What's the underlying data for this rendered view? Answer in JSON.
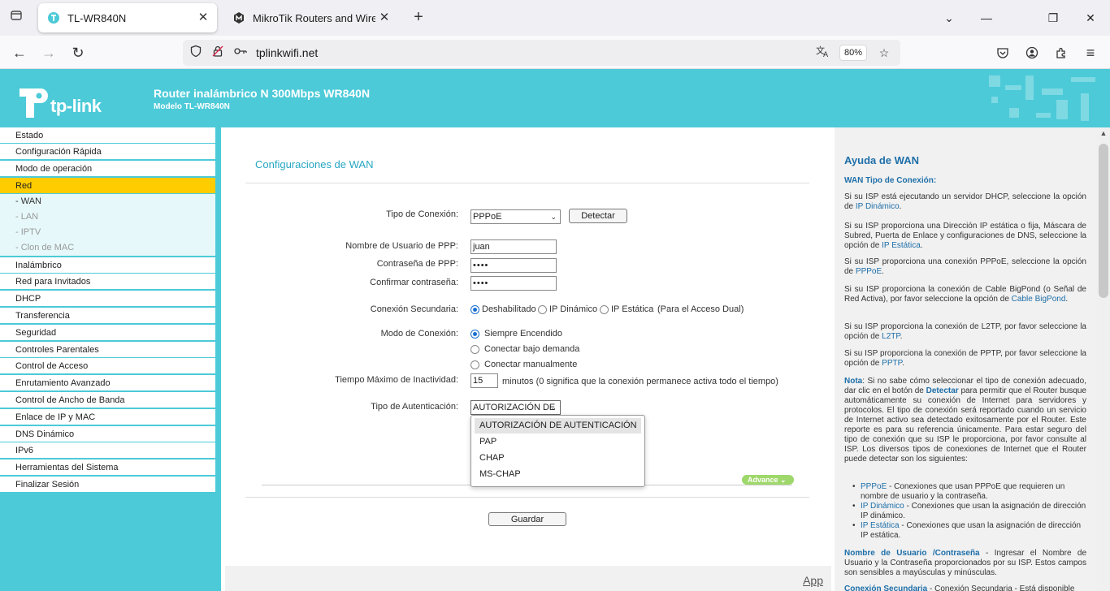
{
  "browser": {
    "tabs": [
      {
        "title": "TL-WR840N",
        "active": true
      },
      {
        "title": "MikroTik Routers and Wireless",
        "active": false
      }
    ],
    "url": "tplinkwifi.net",
    "zoom": "80%"
  },
  "header": {
    "logo_text": "tp-link",
    "title": "Router inalámbrico N 300Mbps WR840N",
    "model": "Modelo TL-WR840N",
    "brand_color": "#4ccad8"
  },
  "menu": {
    "items": [
      {
        "label": "Estado"
      },
      {
        "label": "Configuración Rápida"
      },
      {
        "label": "Modo de operación"
      },
      {
        "label": "Red",
        "active": true
      },
      {
        "label": "- WAN",
        "sub": true,
        "current": true
      },
      {
        "label": "- LAN",
        "sub": true
      },
      {
        "label": "- IPTV",
        "sub": true
      },
      {
        "label": "- Clon de MAC",
        "sub": true
      },
      {
        "label": "Inalámbrico"
      },
      {
        "label": "Red para Invitados"
      },
      {
        "label": "DHCP"
      },
      {
        "label": "Transferencia"
      },
      {
        "label": "Seguridad"
      },
      {
        "label": "Controles Parentales"
      },
      {
        "label": "Control de Acceso"
      },
      {
        "label": "Enrutamiento Avanzado"
      },
      {
        "label": "Control de Ancho de Banda"
      },
      {
        "label": "Enlace de IP y MAC"
      },
      {
        "label": "DNS Dinámico"
      },
      {
        "label": "IPv6"
      },
      {
        "label": "Herramientas del Sistema"
      },
      {
        "label": "Finalizar Sesión"
      }
    ]
  },
  "main": {
    "title": "Configuraciones de WAN",
    "conn_type_label": "Tipo de Conexión:",
    "conn_type_value": "PPPoE",
    "detect_button": "Detectar",
    "username_label": "Nombre de Usuario de PPP:",
    "username_value": "juan",
    "password_label": "Contraseña de PPP:",
    "password_value": "••••",
    "confirm_label": "Confirmar contraseña:",
    "confirm_value": "••••",
    "secondary_label": "Conexión Secundaria:",
    "secondary_options": [
      "Deshabilitado",
      "IP Dinámico",
      "IP Estática"
    ],
    "secondary_note": "(Para el Acceso Dual)",
    "mode_label": "Modo de Conexión:",
    "mode_options": [
      "Siempre Encendido",
      "Conectar bajo demanda",
      "Conectar manualmente"
    ],
    "idle_label": "Tiempo Máximo de Inactividad:",
    "idle_value": "15",
    "idle_note": "minutos (0 significa que la conexión permanece activa todo el tiempo)",
    "auth_label": "Tipo de Autenticación:",
    "auth_value": "AUTORIZACIÓN DE",
    "auth_options": [
      "AUTORIZACIÓN DE AUTENTICACIÓN",
      "PAP",
      "CHAP",
      "MS-CHAP"
    ],
    "advance_button": "Advance",
    "save_button": "Guardar",
    "app_link": "App"
  },
  "help": {
    "title": "Ayuda de WAN",
    "subtitle": "WAN Tipo de Conexión:",
    "p1a": "Si su ISP está ejecutando un servidor DHCP, seleccione la opción de ",
    "p1b": "IP Dinámico",
    "p2a": "Si su ISP proporciona una Dirección IP estática o fija, Máscara de Subred, Puerta de Enlace y configuraciones de DNS, seleccione la opción de ",
    "p2b": "IP Estática",
    "p3a": "Si su ISP proporciona una conexión PPPoE, seleccione la opción de ",
    "p3b": "PPPoE",
    "p4a": "Si su ISP proporciona la conexión de Cable BigPond (o Señal de Red Activa), por favor seleccione la opción de ",
    "p4b": "Cable BigPond",
    "p5a": "Si su ISP proporciona la conexión de L2TP, por favor seleccione la opción de ",
    "p5b": "L2TP",
    "p6a": "Si su ISP proporciona la conexión de PPTP, por favor seleccione la opción de ",
    "p6b": "PPTP",
    "note_label": "Nota",
    "note_a": ": Si no sabe cómo seleccionar el tipo de conexión adecuado, dar clic en el botón de ",
    "note_b": "Detectar",
    "note_c": " para permitir que el Router busque automáticamente su conexión de Internet para servidores y protocolos. El tipo de conexión será reportado cuando un servicio de Internet activo sea detectado exitosamente por el Router. Este reporte es para su referencia únicamente. Para estar seguro del tipo de conexión que su ISP le proporciona, por favor consulte al ISP. Los diversos tipos de conexiones de Internet que el Router puede detectar son los siguientes:",
    "b1a": "PPPoE",
    "b1b": " - Conexiones que usan PPPoE que requieren un nombre de usuario y la contraseña.",
    "b2a": "IP Dinámico",
    "b2b": " - Conexiones que usan la asignación de dirección IP dinámico.",
    "b3a": "IP Estática",
    "b3b": " - Conexiones que usan la asignación de dirección IP estática.",
    "u1a": "Nombre de Usuario /Contraseña",
    "u1b": " - Ingresar el Nombre de Usuario y la Contraseña proporcionados por su ISP. Estos campos son sensibles a mayúsculas y minúsculas.",
    "u2a": "Conexión Secundaria",
    "u2b": " - Conexión Secundaria - Está disponible"
  }
}
